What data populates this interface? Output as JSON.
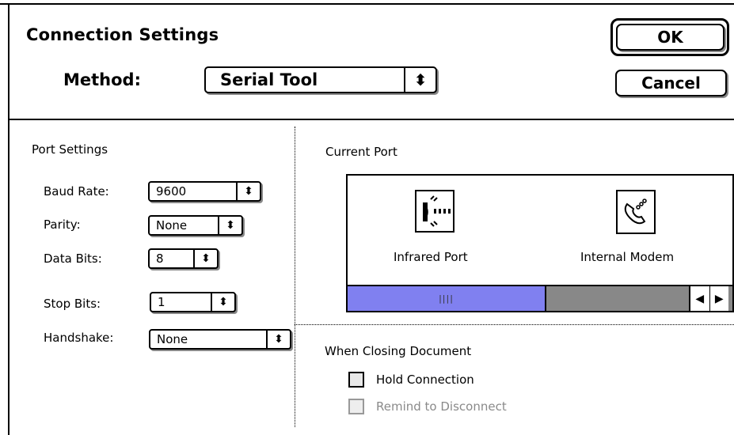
{
  "dialog": {
    "title": "Connection Settings",
    "method_label": "Method:",
    "method_value": "Serial Tool",
    "ok_label": "OK",
    "cancel_label": "Cancel"
  },
  "port_settings": {
    "heading": "Port Settings",
    "fields": [
      {
        "label": "Baud Rate:",
        "value": "9600"
      },
      {
        "label": "Parity:",
        "value": "None"
      },
      {
        "label": "Data Bits:",
        "value": "8"
      },
      {
        "label": "Stop Bits:",
        "value": "1"
      },
      {
        "label": "Handshake:",
        "value": "None"
      }
    ]
  },
  "current_port": {
    "heading": "Current Port",
    "ports": [
      {
        "label": "Infrared Port",
        "icon": "infrared-port-icon"
      },
      {
        "label": "Internal Modem",
        "icon": "modem-phone-icon"
      }
    ],
    "scroll_thumb_glyph": "||||"
  },
  "closing": {
    "heading": "When Closing Document",
    "hold_connection": "Hold Connection",
    "remind_disconnect": "Remind to Disconnect"
  },
  "colors": {
    "scroll_thumb": "#8080f0",
    "scroll_track": "#888888",
    "disabled_text": "#8a8a8a"
  }
}
